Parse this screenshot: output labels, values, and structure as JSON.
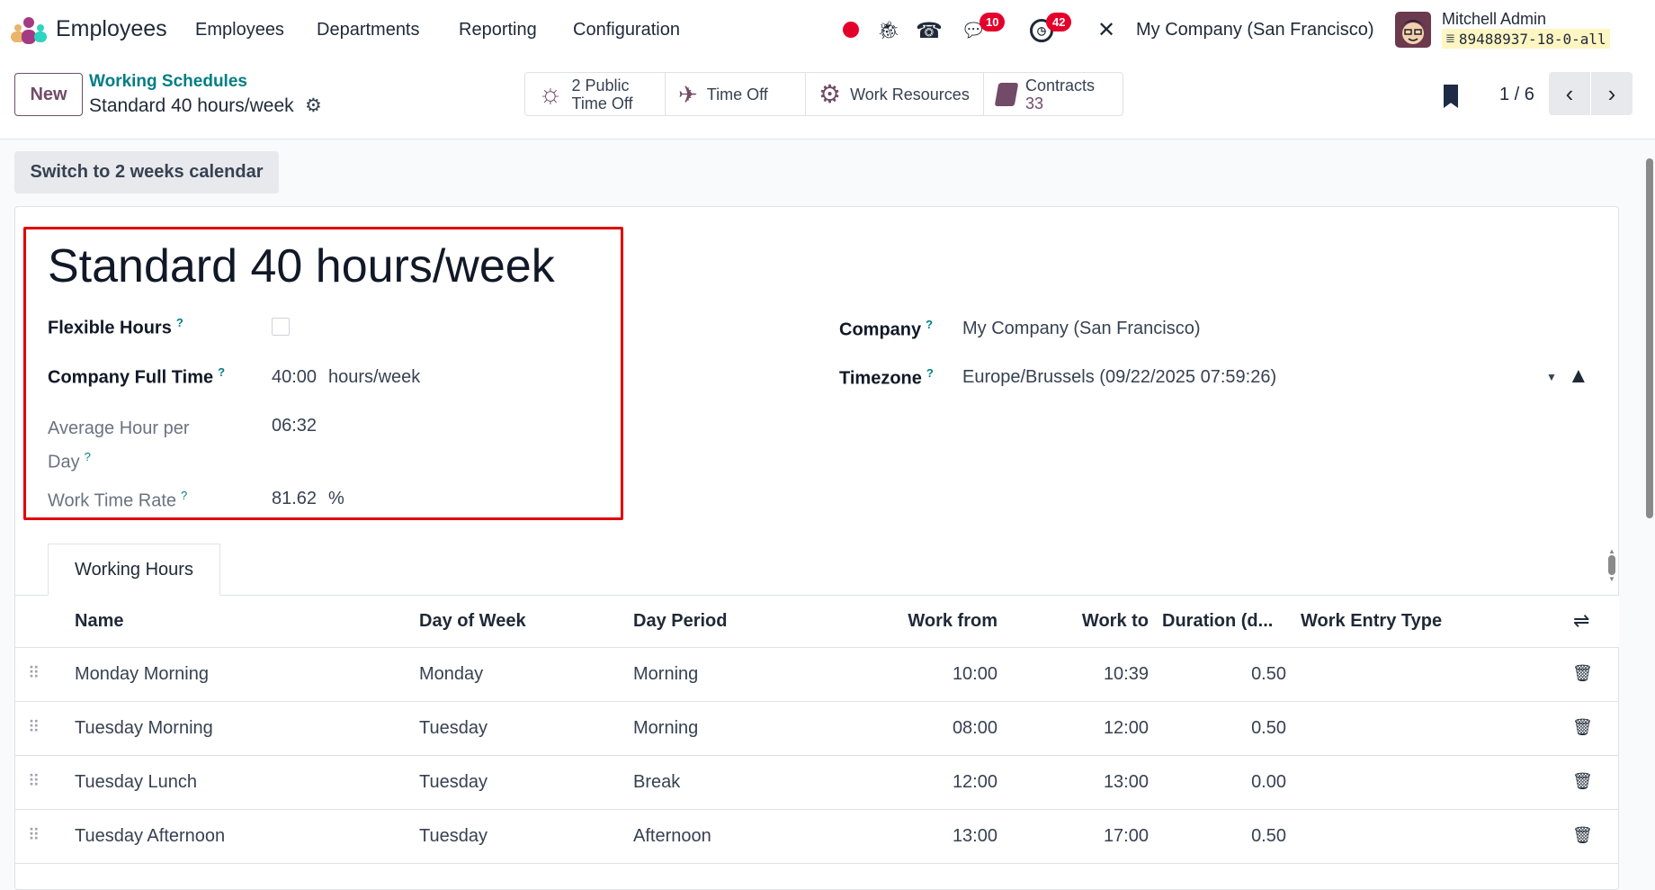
{
  "navbar": {
    "app_name": "Employees",
    "menu": [
      "Employees",
      "Departments",
      "Reporting",
      "Configuration"
    ],
    "chat_badge": "10",
    "activity_badge": "42",
    "company": "My Company (San Francisco)",
    "user_name": "Mitchell Admin",
    "database": "89488937-18-0-all"
  },
  "control_panel": {
    "new_label": "New",
    "breadcrumb_parent": "Working Schedules",
    "breadcrumb_current": "Standard 40 hours/week",
    "stat_buttons": [
      {
        "line1": "2 Public",
        "line2": "Time Off"
      },
      {
        "line1": "Time Off"
      },
      {
        "line1": "Work Resources"
      },
      {
        "line1": "Contracts",
        "line2": "33"
      }
    ],
    "pager": "1 / 6"
  },
  "form": {
    "switch_button": "Switch to 2 weeks calendar",
    "title": "Standard 40 hours/week",
    "flexible_hours_label": "Flexible Hours",
    "flexible_hours": false,
    "full_time_label": "Company Full Time",
    "full_time_value": "40:00",
    "full_time_unit": "hours/week",
    "avg_label_1": "Average Hour per",
    "avg_label_2": "Day",
    "avg_value": "06:32",
    "rate_label": "Work Time Rate",
    "rate_value": "81.62",
    "rate_unit": "%",
    "company_label": "Company",
    "company_value": "My Company (San Francisco)",
    "timezone_label": "Timezone",
    "timezone_value": "Europe/Brussels (09/22/2025 07:59:26)",
    "help": "?"
  },
  "tab": "Working Hours",
  "table": {
    "headers": [
      "Name",
      "Day of Week",
      "Day Period",
      "Work from",
      "Work to",
      "Duration (d...",
      "Work Entry Type"
    ],
    "rows": [
      [
        "Monday Morning",
        "Monday",
        "Morning",
        "10:00",
        "10:39",
        "0.50",
        ""
      ],
      [
        "Tuesday Morning",
        "Tuesday",
        "Morning",
        "08:00",
        "12:00",
        "0.50",
        ""
      ],
      [
        "Tuesday Lunch",
        "Tuesday",
        "Break",
        "12:00",
        "13:00",
        "0.00",
        ""
      ],
      [
        "Tuesday Afternoon",
        "Tuesday",
        "Afternoon",
        "13:00",
        "17:00",
        "0.50",
        ""
      ]
    ]
  },
  "colors": {
    "primary": "#714b67",
    "link": "#017e84",
    "badge": "#e4002b",
    "highlight": "#e00000"
  }
}
